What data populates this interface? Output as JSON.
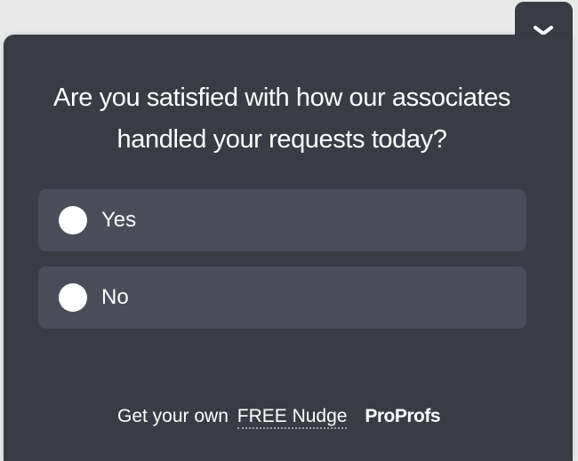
{
  "colors": {
    "panel_bg": "#393c45",
    "option_bg": "#4a4d59",
    "text": "#ffffff",
    "page_bg": "#e9e9ea"
  },
  "collapse_tab": {
    "icon": "chevron-down-icon"
  },
  "survey": {
    "question_line1": "Are you satisfied with how our associates",
    "question_line2": "handled your requests today?",
    "options": [
      {
        "label": "Yes",
        "selected": false
      },
      {
        "label": "No",
        "selected": false
      }
    ]
  },
  "footer": {
    "prefix": "Get your own",
    "link": "FREE Nudge",
    "brand": "ProProfs"
  }
}
